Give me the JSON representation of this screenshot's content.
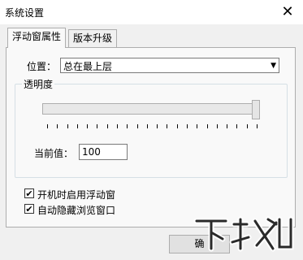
{
  "window": {
    "title": "系统设置",
    "close_glyph": "✕"
  },
  "tabs": [
    {
      "label": "浮动窗属性",
      "active": true
    },
    {
      "label": "版本升级",
      "active": false
    }
  ],
  "position": {
    "label": "位置：",
    "selected": "总在最上层"
  },
  "transparency": {
    "group_title": "透明度",
    "slider_value": 1.0,
    "current_label": "当前值：",
    "current_value": "100"
  },
  "checkboxes": [
    {
      "label": "开机时启用浮动窗",
      "checked": true
    },
    {
      "label": "自动隐藏浏览窗口",
      "checked": true
    }
  ],
  "buttons": {
    "ok_label": "确"
  },
  "watermark": {
    "text": "下载吧"
  }
}
